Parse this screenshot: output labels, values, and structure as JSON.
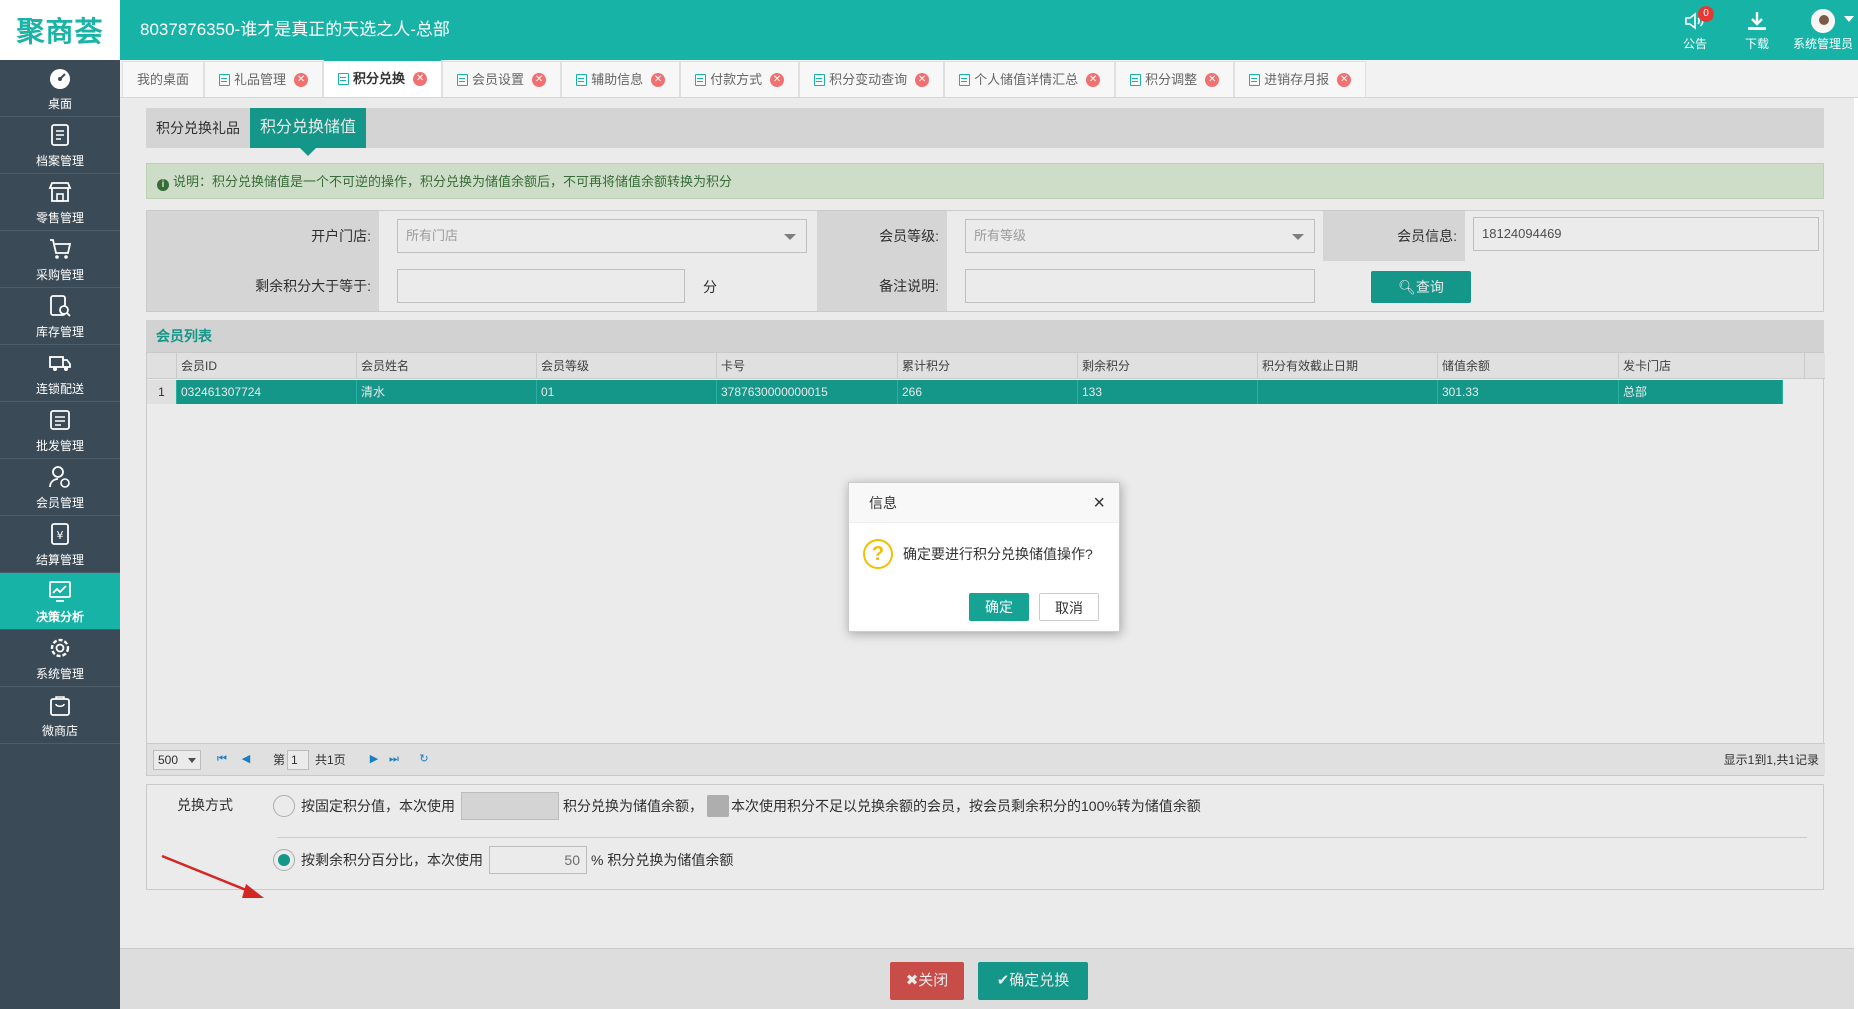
{
  "header": {
    "logo": "聚商荟",
    "title": "8037876350-谁才是真正的天选之人-总部",
    "tools": [
      {
        "label": "公告",
        "icon": "speaker-icon",
        "badge": "0"
      },
      {
        "label": "下载",
        "icon": "download-icon"
      },
      {
        "label": "系统管理员",
        "icon": "user-avatar"
      }
    ]
  },
  "sidebar": {
    "items": [
      {
        "label": "桌面",
        "icon": "dashboard-icon"
      },
      {
        "label": "档案管理",
        "icon": "archive-icon"
      },
      {
        "label": "零售管理",
        "icon": "store-icon"
      },
      {
        "label": "采购管理",
        "icon": "cart-icon"
      },
      {
        "label": "库存管理",
        "icon": "inventory-icon"
      },
      {
        "label": "连锁配送",
        "icon": "truck-icon"
      },
      {
        "label": "批发管理",
        "icon": "wholesale-icon"
      },
      {
        "label": "会员管理",
        "icon": "member-icon"
      },
      {
        "label": "结算管理",
        "icon": "settlement-icon"
      },
      {
        "label": "决策分析",
        "icon": "chart-icon",
        "active": true
      },
      {
        "label": "系统管理",
        "icon": "gear-icon"
      },
      {
        "label": "微商店",
        "icon": "shop-bag-icon"
      }
    ]
  },
  "tabs": [
    {
      "label": "我的桌面"
    },
    {
      "label": "礼品管理"
    },
    {
      "label": "积分兑换",
      "active": true
    },
    {
      "label": "会员设置"
    },
    {
      "label": "辅助信息"
    },
    {
      "label": "付款方式"
    },
    {
      "label": "积分变动查询"
    },
    {
      "label": "个人储值详情汇总"
    },
    {
      "label": "积分调整"
    },
    {
      "label": "进销存月报"
    }
  ],
  "subtabs": {
    "gift": "积分兑换礼品",
    "stored": "积分兑换储值"
  },
  "notice": "说明：积分兑换储值是一个不可逆的操作，积分兑换为储值余额后，不可再将储值余额转换为积分",
  "filter": {
    "store_label": "开户门店:",
    "store_placeholder": "所有门店",
    "level_label": "会员等级:",
    "level_placeholder": "所有等级",
    "info_label": "会员信息:",
    "info_value": "18124094469",
    "points_label": "剩余积分大于等于:",
    "points_unit": "分",
    "remark_label": "备注说明:",
    "query_button": "查询"
  },
  "grid": {
    "title": "会员列表",
    "columns": [
      "会员ID",
      "会员姓名",
      "会员等级",
      "卡号",
      "累计积分",
      "剩余积分",
      "积分有效截止日期",
      "储值余额",
      "发卡门店"
    ],
    "rows": [
      {
        "num": "1",
        "cells": [
          "032461307724",
          "清水",
          "01",
          "3787630000000015",
          "266",
          "133",
          "",
          "301.33",
          "总部"
        ]
      }
    ]
  },
  "pager": {
    "page_size": "500",
    "page_prefix": "第",
    "page_value": "1",
    "page_total": "共1页",
    "summary": "显示1到1,共1记录"
  },
  "mode": {
    "label": "兑换方式",
    "option1_prefix": "按固定积分值，本次使用",
    "option1_suffix": "积分兑换为储值余额，",
    "option1_extra": "本次使用积分不足以兑换余额的会员，按会员剩余积分的100%转为储值余额",
    "option2_prefix": "按剩余积分百分比，本次使用",
    "option2_value": "50",
    "option2_suffix": "% 积分兑换为储值余额",
    "selected": 2
  },
  "footer": {
    "close_button": "关闭",
    "confirm_button": "确定兑换"
  },
  "dialog": {
    "title": "信息",
    "message": "确定要进行积分兑换储值操作?",
    "ok": "确定",
    "cancel": "取消"
  },
  "colors": {
    "primary": "#16b3a6",
    "sidebar": "#3a4a56",
    "danger": "#d9534f"
  }
}
